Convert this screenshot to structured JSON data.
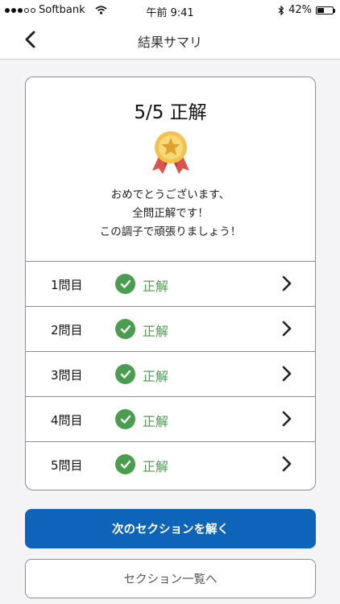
{
  "status_bar": {
    "carrier": "Softbank",
    "time": "午前 9:41",
    "battery": "42%",
    "battery_level": 0.42,
    "signal_bars_filled": 3,
    "signal_bars_total": 5
  },
  "nav": {
    "title": "結果サマリ",
    "back_icon": "chevron-left-icon"
  },
  "summary": {
    "score": "5/5 正解",
    "medal_icon": "medal-star-icon",
    "message_lines": [
      "おめでとうございます、",
      "全問正解です！",
      "この調子で頑張りましょう！"
    ]
  },
  "questions": [
    {
      "label": "1問目",
      "result": "正解"
    },
    {
      "label": "2問目",
      "result": "正解"
    },
    {
      "label": "3問目",
      "result": "正解"
    },
    {
      "label": "4問目",
      "result": "正解"
    },
    {
      "label": "5問目",
      "result": "正解"
    }
  ],
  "actions": {
    "next_section": "次のセクションを解く",
    "section_list": "セクション一覧へ"
  },
  "colors": {
    "accent": "#0d64b8",
    "correct": "#4a9d4e",
    "medal_gold": "#f2c14e",
    "ribbon": "#d9534f"
  }
}
